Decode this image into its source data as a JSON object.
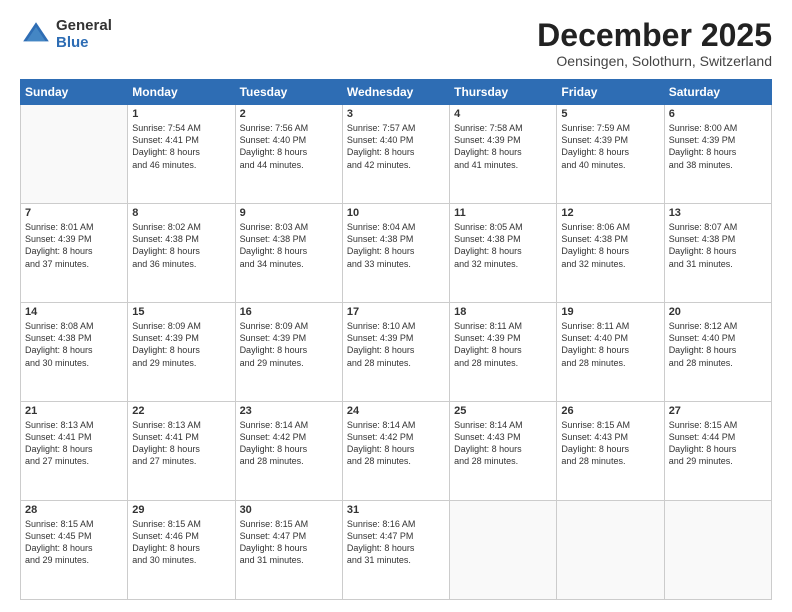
{
  "header": {
    "logo_general": "General",
    "logo_blue": "Blue",
    "month_title": "December 2025",
    "subtitle": "Oensingen, Solothurn, Switzerland"
  },
  "days_of_week": [
    "Sunday",
    "Monday",
    "Tuesday",
    "Wednesday",
    "Thursday",
    "Friday",
    "Saturday"
  ],
  "weeks": [
    [
      {
        "day": "",
        "content": ""
      },
      {
        "day": "1",
        "content": "Sunrise: 7:54 AM\nSunset: 4:41 PM\nDaylight: 8 hours\nand 46 minutes."
      },
      {
        "day": "2",
        "content": "Sunrise: 7:56 AM\nSunset: 4:40 PM\nDaylight: 8 hours\nand 44 minutes."
      },
      {
        "day": "3",
        "content": "Sunrise: 7:57 AM\nSunset: 4:40 PM\nDaylight: 8 hours\nand 42 minutes."
      },
      {
        "day": "4",
        "content": "Sunrise: 7:58 AM\nSunset: 4:39 PM\nDaylight: 8 hours\nand 41 minutes."
      },
      {
        "day": "5",
        "content": "Sunrise: 7:59 AM\nSunset: 4:39 PM\nDaylight: 8 hours\nand 40 minutes."
      },
      {
        "day": "6",
        "content": "Sunrise: 8:00 AM\nSunset: 4:39 PM\nDaylight: 8 hours\nand 38 minutes."
      }
    ],
    [
      {
        "day": "7",
        "content": "Sunrise: 8:01 AM\nSunset: 4:39 PM\nDaylight: 8 hours\nand 37 minutes."
      },
      {
        "day": "8",
        "content": "Sunrise: 8:02 AM\nSunset: 4:38 PM\nDaylight: 8 hours\nand 36 minutes."
      },
      {
        "day": "9",
        "content": "Sunrise: 8:03 AM\nSunset: 4:38 PM\nDaylight: 8 hours\nand 34 minutes."
      },
      {
        "day": "10",
        "content": "Sunrise: 8:04 AM\nSunset: 4:38 PM\nDaylight: 8 hours\nand 33 minutes."
      },
      {
        "day": "11",
        "content": "Sunrise: 8:05 AM\nSunset: 4:38 PM\nDaylight: 8 hours\nand 32 minutes."
      },
      {
        "day": "12",
        "content": "Sunrise: 8:06 AM\nSunset: 4:38 PM\nDaylight: 8 hours\nand 32 minutes."
      },
      {
        "day": "13",
        "content": "Sunrise: 8:07 AM\nSunset: 4:38 PM\nDaylight: 8 hours\nand 31 minutes."
      }
    ],
    [
      {
        "day": "14",
        "content": "Sunrise: 8:08 AM\nSunset: 4:38 PM\nDaylight: 8 hours\nand 30 minutes."
      },
      {
        "day": "15",
        "content": "Sunrise: 8:09 AM\nSunset: 4:39 PM\nDaylight: 8 hours\nand 29 minutes."
      },
      {
        "day": "16",
        "content": "Sunrise: 8:09 AM\nSunset: 4:39 PM\nDaylight: 8 hours\nand 29 minutes."
      },
      {
        "day": "17",
        "content": "Sunrise: 8:10 AM\nSunset: 4:39 PM\nDaylight: 8 hours\nand 28 minutes."
      },
      {
        "day": "18",
        "content": "Sunrise: 8:11 AM\nSunset: 4:39 PM\nDaylight: 8 hours\nand 28 minutes."
      },
      {
        "day": "19",
        "content": "Sunrise: 8:11 AM\nSunset: 4:40 PM\nDaylight: 8 hours\nand 28 minutes."
      },
      {
        "day": "20",
        "content": "Sunrise: 8:12 AM\nSunset: 4:40 PM\nDaylight: 8 hours\nand 28 minutes."
      }
    ],
    [
      {
        "day": "21",
        "content": "Sunrise: 8:13 AM\nSunset: 4:41 PM\nDaylight: 8 hours\nand 27 minutes."
      },
      {
        "day": "22",
        "content": "Sunrise: 8:13 AM\nSunset: 4:41 PM\nDaylight: 8 hours\nand 27 minutes."
      },
      {
        "day": "23",
        "content": "Sunrise: 8:14 AM\nSunset: 4:42 PM\nDaylight: 8 hours\nand 28 minutes."
      },
      {
        "day": "24",
        "content": "Sunrise: 8:14 AM\nSunset: 4:42 PM\nDaylight: 8 hours\nand 28 minutes."
      },
      {
        "day": "25",
        "content": "Sunrise: 8:14 AM\nSunset: 4:43 PM\nDaylight: 8 hours\nand 28 minutes."
      },
      {
        "day": "26",
        "content": "Sunrise: 8:15 AM\nSunset: 4:43 PM\nDaylight: 8 hours\nand 28 minutes."
      },
      {
        "day": "27",
        "content": "Sunrise: 8:15 AM\nSunset: 4:44 PM\nDaylight: 8 hours\nand 29 minutes."
      }
    ],
    [
      {
        "day": "28",
        "content": "Sunrise: 8:15 AM\nSunset: 4:45 PM\nDaylight: 8 hours\nand 29 minutes."
      },
      {
        "day": "29",
        "content": "Sunrise: 8:15 AM\nSunset: 4:46 PM\nDaylight: 8 hours\nand 30 minutes."
      },
      {
        "day": "30",
        "content": "Sunrise: 8:15 AM\nSunset: 4:47 PM\nDaylight: 8 hours\nand 31 minutes."
      },
      {
        "day": "31",
        "content": "Sunrise: 8:16 AM\nSunset: 4:47 PM\nDaylight: 8 hours\nand 31 minutes."
      },
      {
        "day": "",
        "content": ""
      },
      {
        "day": "",
        "content": ""
      },
      {
        "day": "",
        "content": ""
      }
    ]
  ]
}
